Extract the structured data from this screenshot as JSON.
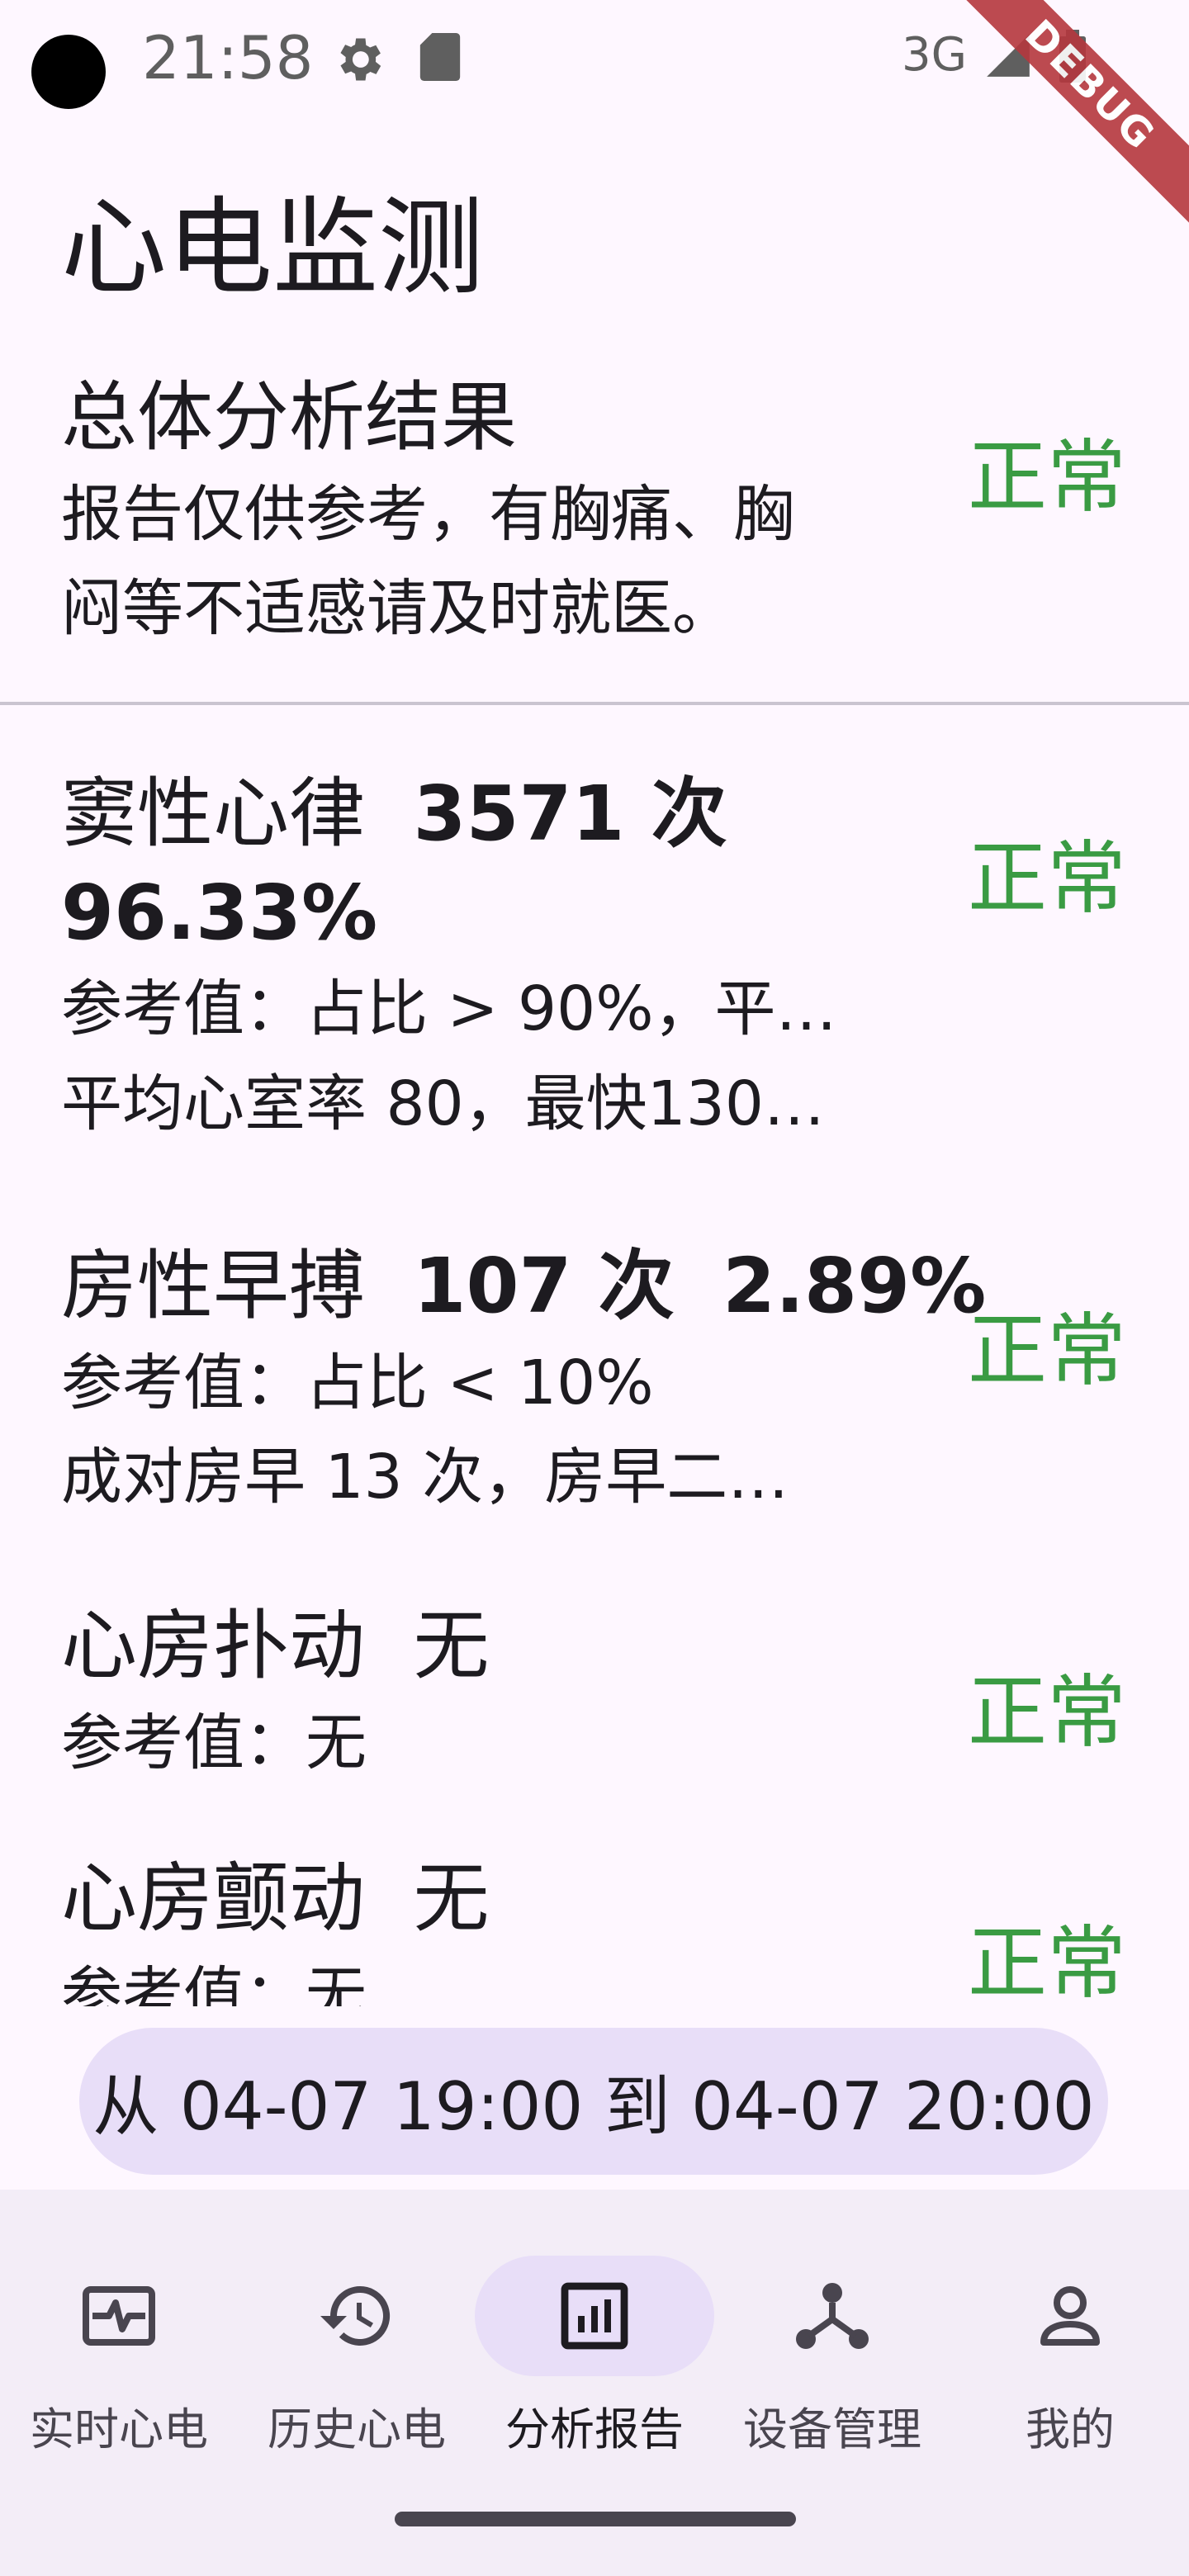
{
  "status_bar": {
    "time": "21:58",
    "network": "3G",
    "icons": [
      "gear-icon",
      "sdcard-icon",
      "signal-icon",
      "battery-icon"
    ]
  },
  "debug_banner": "DEBUG",
  "page_title": "心电监测",
  "summary": {
    "title": "总体分析结果",
    "desc_line1": "报告仅供参考，有胸痛、胸",
    "desc_line2": "闷等不适感请及时就医。",
    "status": "正常"
  },
  "items": [
    {
      "name": "窦性心律",
      "count": "3571 次",
      "percent": "96.33%",
      "ref": "参考值：占比 > 90%，平…",
      "extra": "平均心室率 80，最快130…",
      "status": "正常"
    },
    {
      "name": "房性早搏",
      "count": "107 次",
      "percent": "2.89%",
      "ref": "参考值：占比 < 10%",
      "extra": "成对房早 13 次，房早二…",
      "status": "正常"
    },
    {
      "name": "心房扑动",
      "value": "无",
      "ref": "参考值：无",
      "status": "正常"
    },
    {
      "name": "心房颤动",
      "value": "无",
      "ref": "参考值：无",
      "status": "正常"
    }
  ],
  "date_range": "从 04-07 19:00 到 04-07 20:00",
  "bottom_nav": [
    {
      "label": "实时心电",
      "icon": "ecg-monitor-icon",
      "active": false
    },
    {
      "label": "历史心电",
      "icon": "history-icon",
      "active": false
    },
    {
      "label": "分析报告",
      "icon": "analytics-icon",
      "active": true
    },
    {
      "label": "设备管理",
      "icon": "device-hub-icon",
      "active": false
    },
    {
      "label": "我的",
      "icon": "person-icon",
      "active": false
    }
  ],
  "colors": {
    "background": "#fef7ff",
    "status_normal": "#3a9b43",
    "pill": "#e8def8",
    "nav_background": "#f3edf7"
  }
}
